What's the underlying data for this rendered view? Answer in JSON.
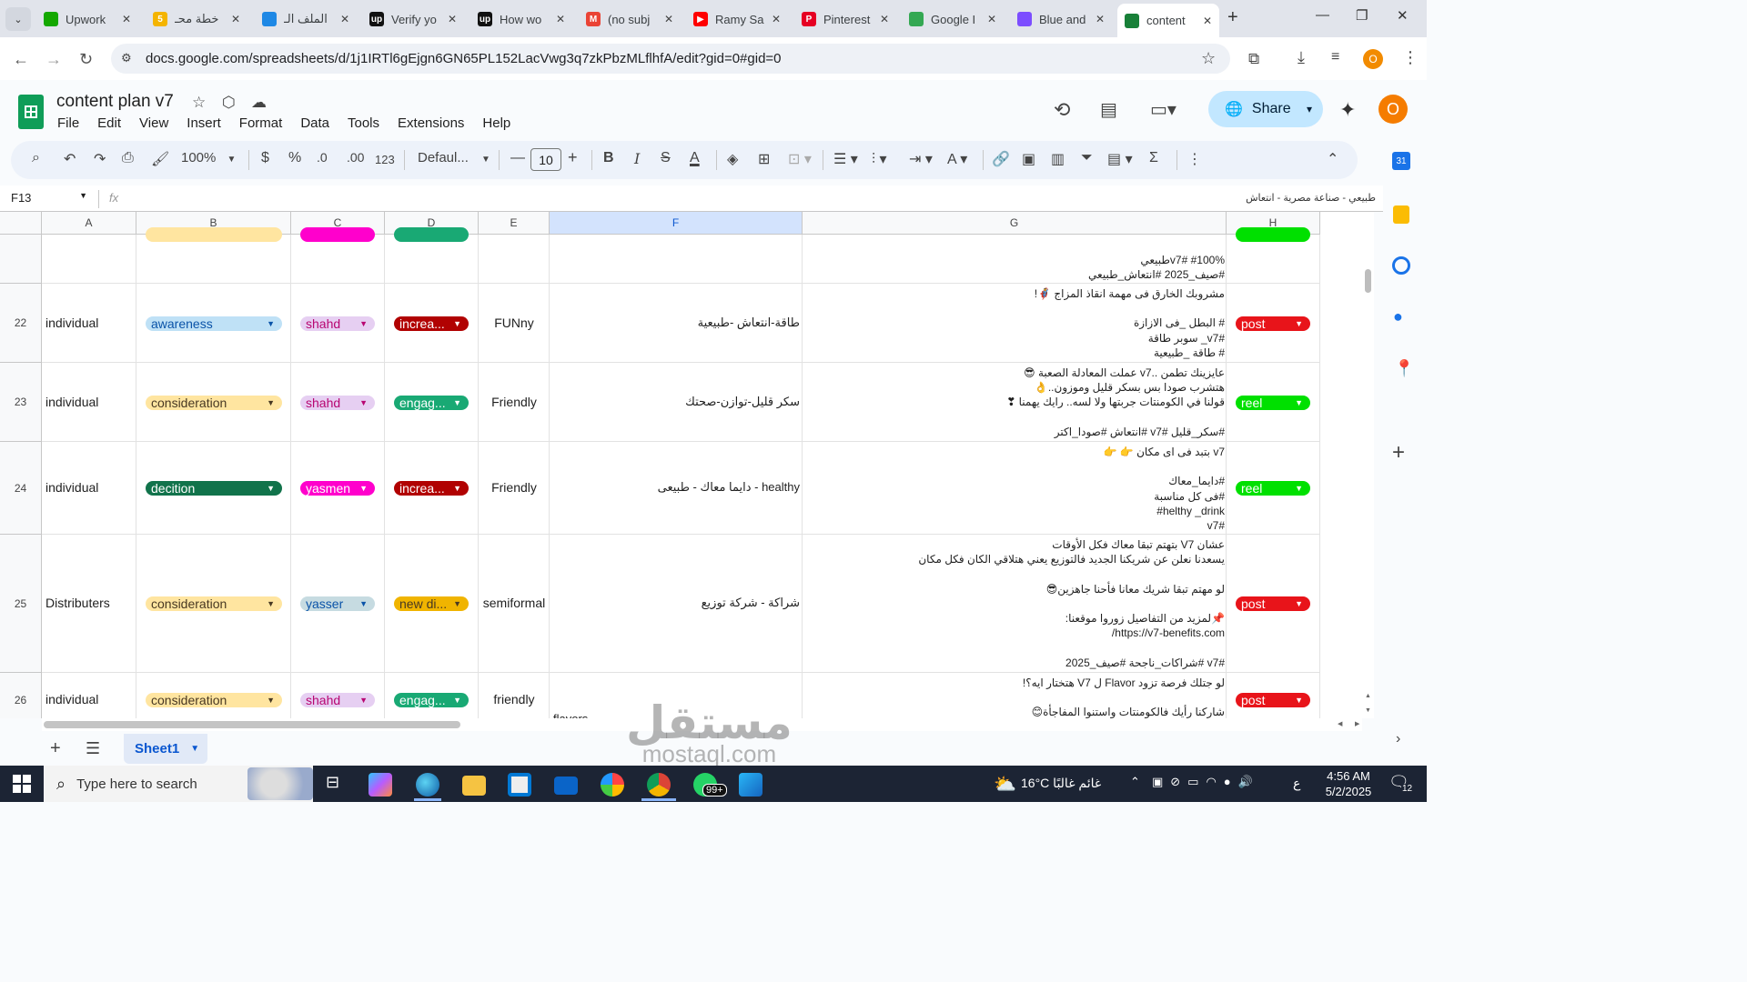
{
  "browser": {
    "tabs": [
      {
        "title": "Upwork",
        "fav_color": "#14a800",
        "fav_text": ""
      },
      {
        "title": "خطة محـ",
        "fav_color": "#f4b400",
        "fav_text": "5"
      },
      {
        "title": "الملف الـ",
        "fav_color": "#1e88e5",
        "fav_text": ""
      },
      {
        "title": "Verify yo",
        "fav_color": "#111111",
        "fav_text": "up"
      },
      {
        "title": "How wo",
        "fav_color": "#111111",
        "fav_text": "up"
      },
      {
        "title": "(no subj",
        "fav_color": "#ea4335",
        "fav_text": "M"
      },
      {
        "title": "Ramy Sa",
        "fav_color": "#ff0000",
        "fav_text": "▶"
      },
      {
        "title": "Pinterest",
        "fav_color": "#e60023",
        "fav_text": "P"
      },
      {
        "title": "Google I",
        "fav_color": "#34a853",
        "fav_text": ""
      },
      {
        "title": "Blue and",
        "fav_color": "#7c4dff",
        "fav_text": ""
      },
      {
        "title": "content",
        "fav_color": "#188038",
        "fav_text": ""
      }
    ],
    "url": "docs.google.com/spreadsheets/d/1j1IRTl6gEjgn6GN65PL152LacVwg3q7zkPbzMLflhfA/edit?gid=0#gid=0",
    "profile_initial": "O"
  },
  "app": {
    "doc_title": "content plan v7",
    "menu": [
      "File",
      "Edit",
      "View",
      "Insert",
      "Format",
      "Data",
      "Tools",
      "Extensions",
      "Help"
    ],
    "share_label": "Share",
    "avatar_initial": "O"
  },
  "toolbar": {
    "zoom": "100%",
    "currency": "$",
    "percent": "%",
    "dec_decrease": ".0",
    "dec_increase": ".00",
    "number_format": "123",
    "font": "Defaul...",
    "font_size": "10"
  },
  "formula_bar": {
    "cell_ref": "F13",
    "fx": "fx",
    "content": "طبيعي - صناعة مصرية - انتعاش"
  },
  "grid": {
    "columns": [
      "A",
      "B",
      "C",
      "D",
      "E",
      "F",
      "G",
      "H"
    ],
    "top_partial": {
      "g_text": "#100% #v7طبيعي\n#صيف_2025 #انتعاش_طبيعي"
    },
    "rows": [
      {
        "num": "22",
        "a": "individual",
        "b": "awareness",
        "c": "shahd",
        "d": "increa...",
        "e": "FUNny",
        "f": "طاقة-انتعاش -طبيعية",
        "g": "مشروبك الخارق فى مهمة انقاذ المزاج 🦸!\n\n# البطل _فى الازازة\n#v7_ سوبر طاقة\n# طاقة _طبيعية",
        "h": "post"
      },
      {
        "num": "23",
        "a": "individual",
        "b": "consideration",
        "c": "shahd",
        "d": "engag...",
        "e": "Friendly",
        "f": "سكر قليل-توازن-صحتك",
        "g": "عايزينك تطمن ..v7 عملت المعادلة الصعبة 😎\nهتشرب صودا بس بسكر قليل وموزون..👌\nقولنا في الكومنتات جربتها ولا لسه.. رايك يهمنا ❣\n\n#سكر_قليل #v7 #انتعاش #صودا_اكتر",
        "h": "reel"
      },
      {
        "num": "24",
        "a": "individual",
        "b": "decition",
        "c": "yasmen",
        "d": "increa...",
        "e": "Friendly",
        "f": "healthy - دايما معاك - طبيعى",
        "g": "v7 بتبد فى اى مكان 👉 👉\n\n#دايما_معاك\n#فى كل مناسبة\nhelthy _drink#\n#v7",
        "h": "reel"
      },
      {
        "num": "25",
        "a": "Distributers",
        "b": "consideration",
        "c": "yasser",
        "d": "new di...",
        "e": "semiformal",
        "f": "شراكة - شركة توزيع",
        "g": "عشان V7 بتهتم تبقا معاك فكل الأوقات\nيسعدنا نعلن عن شريكنا الجديد فالتوزيع يعني هتلاقي الكان فكل مكان\n\nلو مهتم تبقا شريك معانا فأحنا جاهزين😎\n\n📌لمزيد من التفاصيل زوروا موقعنا:\nhttps://v7-benefits.com/\n\n#v7 #شراكات_ناجحة #صيف_2025",
        "h": "post"
      },
      {
        "num": "26",
        "a": "individual",
        "b": "consideration",
        "c": "shahd",
        "d": "engag...",
        "e": "friendly",
        "f": "flavors",
        "g": "لو جتلك فرصة تزود Flavor ل V7 هتختار ايه؟!\n\nشاركنا رأيك فالكومنتات واستنوا المفاجأة😊",
        "h": "post"
      }
    ]
  },
  "sheets": {
    "active": "Sheet1"
  },
  "taskbar": {
    "search_placeholder": "Type here to search",
    "weather": "16°C  غائم غالبًا",
    "lang": "ع",
    "time": "4:56 AM",
    "date": "5/2/2025",
    "whatsapp_badge": "99+",
    "notif_count": "12"
  },
  "watermark": {
    "text": "مستقل",
    "sub": "mostaql.com"
  },
  "colors": {
    "awareness": "#bfe1f6",
    "consideration": "#ffe5a0",
    "decition": "#11734b",
    "shahd": "#e6cff2",
    "yasmen": "#ff00cc",
    "yasser": "#c6dbe1",
    "increa": "#b10202",
    "engag": "#19a974",
    "newdi": "#f0b400",
    "post": "#e8141a",
    "reel": "#00e000"
  }
}
